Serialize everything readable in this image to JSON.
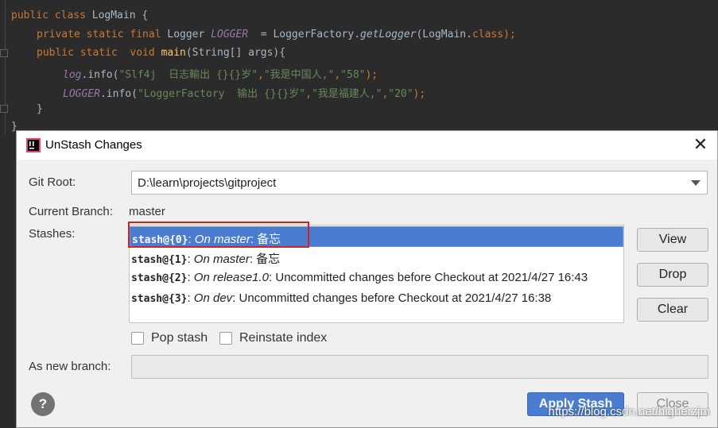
{
  "editor": {
    "line0": "",
    "class_decl": {
      "kw": "public class ",
      "name": "LogMain {"
    },
    "logger_decl": {
      "kw": "private static final ",
      "type": "Logger ",
      "const": "LOGGER",
      "eq": "  = LoggerFactory.",
      "method": "getLogger",
      "args": "(LogMain.",
      "cls": "class",
      "end": ");"
    },
    "main_decl": {
      "kw": "public static  void ",
      "name": "main",
      "args": "(String[] args){"
    },
    "log_line": {
      "var": "log",
      "call": ".info(",
      "s1": "\"Slf4j  日志輸出 {}{}岁\"",
      "c1": ",",
      "s2": "\"我是中国人,\"",
      "c2": ",",
      "s3": "\"58\"",
      "end": ");"
    },
    "logger_line": {
      "var": "LOGGER",
      "call": ".info(",
      "s1": "\"LoggerFactory  输出 {}{}岁\"",
      "c1": ",",
      "s2": "\"我是福建人,\"",
      "c2": ",",
      "s3": "\"20\"",
      "end": ");"
    },
    "close_inner": "}",
    "close_outer": "}"
  },
  "dialog": {
    "title": "UnStash Changes",
    "git_root_label": "Git Root:",
    "git_root_value": "D:\\learn\\projects\\gitproject",
    "current_branch_label": "Current Branch:",
    "current_branch_value": "master",
    "stashes_label": "Stashes:",
    "stashes": [
      {
        "id": "stash@{0}",
        "sep": ": ",
        "branch": "On master",
        "msg": ": 备忘"
      },
      {
        "id": "stash@{1}",
        "sep": ": ",
        "branch": "On master",
        "msg": ": 备忘"
      },
      {
        "id": "stash@{2}",
        "sep": ": ",
        "branch": "On release1.0",
        "msg": ": Uncommitted changes before Checkout at 2021/4/27 16:43"
      },
      {
        "id": "stash@{3}",
        "sep": ": ",
        "branch": "On dev",
        "msg": ": Uncommitted changes before Checkout at 2021/4/27 16:38"
      }
    ],
    "buttons": {
      "view": "View",
      "drop": "Drop",
      "clear": "Clear",
      "apply": "Apply Stash",
      "close": "Close",
      "help": "?"
    },
    "pop_stash_label": "Pop stash",
    "reinstate_index_label": "Reinstate index",
    "new_branch_label": "As new branch:",
    "new_branch_value": ""
  },
  "watermark": "https://blog.csdn.net/higherzjm",
  "colors": {
    "selection": "#4a7cd1",
    "highlight_box": "#d82020",
    "editor_bg": "#2b2b2b"
  }
}
